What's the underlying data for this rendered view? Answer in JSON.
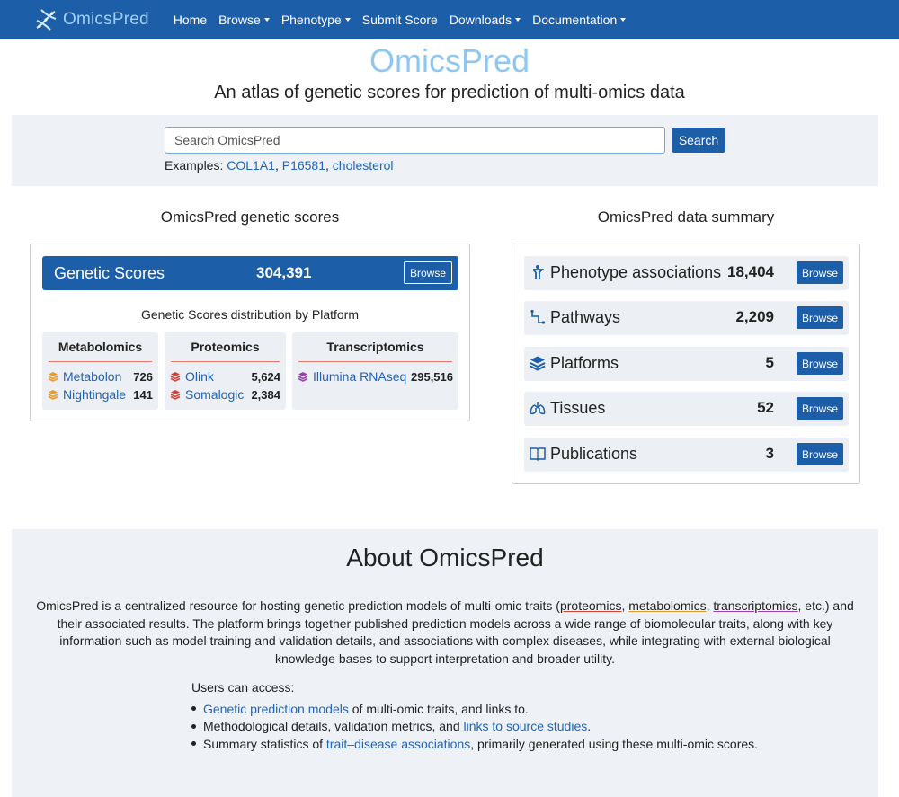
{
  "nav": {
    "brand": "OmicsPred",
    "items": [
      {
        "label": "Home",
        "dropdown": false
      },
      {
        "label": "Browse",
        "dropdown": true
      },
      {
        "label": "Phenotype",
        "dropdown": true
      },
      {
        "label": "Submit Score",
        "dropdown": false
      },
      {
        "label": "Downloads",
        "dropdown": true
      },
      {
        "label": "Documentation",
        "dropdown": true
      }
    ]
  },
  "hero": {
    "title": "OmicsPred",
    "tagline": "An atlas of genetic scores for prediction of multi-omics data"
  },
  "search": {
    "placeholder": "Search OmicsPred",
    "button": "Search",
    "examples_label": "Examples:",
    "examples": [
      "COL1A1",
      "P16581",
      "cholesterol"
    ]
  },
  "genetic_scores": {
    "heading": "OmicsPred genetic scores",
    "title": "Genetic Scores",
    "count": "304,391",
    "browse": "Browse",
    "distribution_title": "Genetic Scores distribution by Platform",
    "platforms": [
      {
        "name": "Metabolomics",
        "color": "#e99a2c",
        "items": [
          {
            "label": "Metabolon",
            "value": "726"
          },
          {
            "label": "Nightingale",
            "value": "141"
          }
        ]
      },
      {
        "name": "Proteomics",
        "color": "#d0453a",
        "items": [
          {
            "label": "Olink",
            "value": "5,624"
          },
          {
            "label": "Somalogic",
            "value": "2,384"
          }
        ]
      },
      {
        "name": "Transcriptomics",
        "color": "#9c3fb2",
        "items": [
          {
            "label": "Illumina RNAseq",
            "value": "295,516"
          }
        ]
      }
    ]
  },
  "data_summary": {
    "heading": "OmicsPred data summary",
    "rows": [
      {
        "icon": "person-icon",
        "label": "Phenotype associations",
        "value": "18,404",
        "button": "Browse"
      },
      {
        "icon": "pathway-icon",
        "label": "Pathways",
        "value": "2,209",
        "button": "Browse"
      },
      {
        "icon": "layers-icon",
        "label": "Platforms",
        "value": "5",
        "button": "Browse"
      },
      {
        "icon": "lungs-icon",
        "label": "Tissues",
        "value": "52",
        "button": "Browse"
      },
      {
        "icon": "book-icon",
        "label": "Publications",
        "value": "3",
        "button": "Browse"
      }
    ]
  },
  "about": {
    "title": "About OmicsPred",
    "p1_a": "OmicsPred is a centralized resource for hosting genetic prediction models of multi-omic traits (",
    "proteomics": "proteomics",
    "comma1": ", ",
    "metabolomics": "metabolomics",
    "comma2": ", ",
    "transcriptomics": "transcriptomics",
    "p1_b": ", etc.) and their associated results. The platform brings together published prediction models across a wide range of biomolecular traits, along with key information such as model training and validation details, and associations with complex diseases, while integrating with external biological knowledge bases to support interpretation and broader utility.",
    "access_intro": "Users can access:",
    "access": [
      {
        "link": "Genetic prediction models",
        "pre": "",
        "post": " of multi-omic traits, and links to."
      },
      {
        "link": "links to source studies",
        "pre": "Methodological details, validation metrics, and ",
        "post": "."
      },
      {
        "link": "trait–disease associations",
        "pre": "Summary statistics of ",
        "post": ", primarily generated using these multi-omic scores."
      }
    ]
  }
}
